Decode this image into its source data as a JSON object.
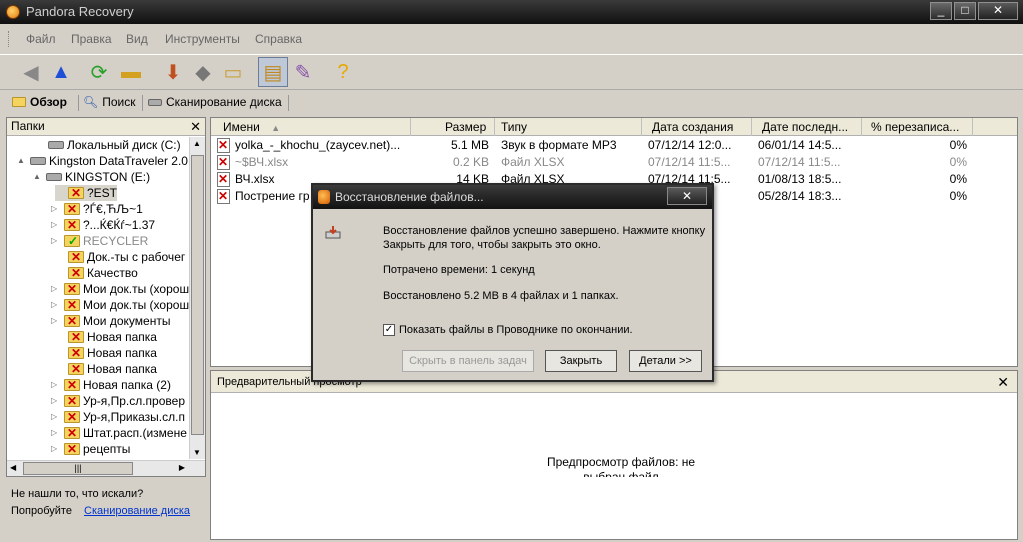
{
  "window": {
    "title": "Pandora Recovery",
    "min": "_",
    "max": "□",
    "close": "✕"
  },
  "menu": [
    "Файл",
    "Правка",
    "Вид",
    "Инструменты",
    "Справка"
  ],
  "tabs": [
    "Обзор",
    "Поиск",
    "Сканирование диска"
  ],
  "folders": {
    "header": "Папки",
    "close": "✕",
    "items": [
      {
        "label": "Локальный диск (C:)",
        "icon": "drive",
        "gray": false,
        "selected": false,
        "expander": ""
      },
      {
        "label": "Kingston DataTraveler 2.0",
        "icon": "drive",
        "gray": false,
        "selected": false,
        "expander": "▲"
      },
      {
        "label": "KINGSTON (E:)",
        "icon": "drive",
        "gray": false,
        "selected": false,
        "expander": "▲"
      },
      {
        "label": "?EST",
        "icon": "folder-x",
        "gray": false,
        "selected": true,
        "expander": ""
      },
      {
        "label": "?Ѓ€,ЋЉ~1",
        "icon": "folder-x",
        "gray": false,
        "selected": false,
        "expander": "▷"
      },
      {
        "label": "?...Ќ€Ќѓ~1.37",
        "icon": "folder-x",
        "gray": false,
        "selected": false,
        "expander": "▷"
      },
      {
        "label": "RECYCLER",
        "icon": "folder-check",
        "gray": true,
        "selected": false,
        "expander": "▷"
      },
      {
        "label": "Док.-ты с рабочег",
        "icon": "folder-x",
        "gray": false,
        "selected": false,
        "expander": ""
      },
      {
        "label": "Качество",
        "icon": "folder-x",
        "gray": false,
        "selected": false,
        "expander": ""
      },
      {
        "label": "Мои док.ты (хорош",
        "icon": "folder-x",
        "gray": false,
        "selected": false,
        "expander": "▷"
      },
      {
        "label": "Мои док.ты (хорош",
        "icon": "folder-x",
        "gray": false,
        "selected": false,
        "expander": "▷"
      },
      {
        "label": "Мои документы",
        "icon": "folder-x",
        "gray": false,
        "selected": false,
        "expander": "▷"
      },
      {
        "label": "Новая папка",
        "icon": "folder-x",
        "gray": false,
        "selected": false,
        "expander": ""
      },
      {
        "label": "Новая папка",
        "icon": "folder-x",
        "gray": false,
        "selected": false,
        "expander": ""
      },
      {
        "label": "Новая папка",
        "icon": "folder-x",
        "gray": false,
        "selected": false,
        "expander": ""
      },
      {
        "label": "Новая папка (2)",
        "icon": "folder-x",
        "gray": false,
        "selected": false,
        "expander": "▷"
      },
      {
        "label": "Ур-я,Пр.сл.провер",
        "icon": "folder-x",
        "gray": false,
        "selected": false,
        "expander": "▷"
      },
      {
        "label": "Ур-я,Приказы.сл.п",
        "icon": "folder-x",
        "gray": false,
        "selected": false,
        "expander": "▷"
      },
      {
        "label": "Штат.расп.(измене",
        "icon": "folder-x",
        "gray": false,
        "selected": false,
        "expander": "▷"
      },
      {
        "label": "рецепты",
        "icon": "folder-x",
        "gray": false,
        "selected": false,
        "expander": "▷"
      }
    ],
    "hscroll_thumb": "|||"
  },
  "hint": {
    "question": "Не нашли то, что искали?",
    "try": "Попробуйте",
    "link": "Сканирование диска"
  },
  "files": {
    "columns": [
      "Имени",
      "Размер",
      "Типу",
      "Дата создания",
      "Дате последн...",
      "% перезаписа..."
    ],
    "sort_arrow": "▲",
    "rows": [
      {
        "name": "yolka_-_khochu_(zaycev.net)...",
        "size": "5.1 MB",
        "type": "Звук в формате MP3",
        "created": "07/12/14 12:0...",
        "modified": "06/01/14 14:5...",
        "overwrite": "0%",
        "gray": false
      },
      {
        "name": "~$ВЧ.xlsx",
        "size": "0.2 KB",
        "type": "Файл XLSX",
        "created": "07/12/14 11:5...",
        "modified": "07/12/14 11:5...",
        "overwrite": "0%",
        "gray": true
      },
      {
        "name": "ВЧ.xlsx",
        "size": "14 KB",
        "type": "Файл XLSX",
        "created": "07/12/14 11:5...",
        "modified": "01/08/13 18:5...",
        "overwrite": "0%",
        "gray": false
      },
      {
        "name": "Пострение гр",
        "size": "",
        "type": "",
        "created": "",
        "modified": "05/28/14 18:3...",
        "overwrite": "0%",
        "gray": false
      }
    ]
  },
  "preview": {
    "header": "Предварительный просмотр",
    "close": "✕",
    "message": "Предпросмотр файлов: не выбран файл"
  },
  "dialog": {
    "title": "Восстановление файлов...",
    "close": "✕",
    "line1": "Восстановление файлов успешно завершено. Нажмите кнопку",
    "line2": "Закрыть для того, чтобы закрыть это окно.",
    "time": "Потрачено времени: 1 секунд",
    "result": "Восстановлено 5.2 MB в 4 файлах и 1 папках.",
    "checkbox_label": "Показать файлы в Проводнике по окончании.",
    "checkbox_checked": true,
    "btn_tray": "Скрыть в панель задач",
    "btn_close": "Закрыть",
    "btn_details": "Детали >>"
  }
}
